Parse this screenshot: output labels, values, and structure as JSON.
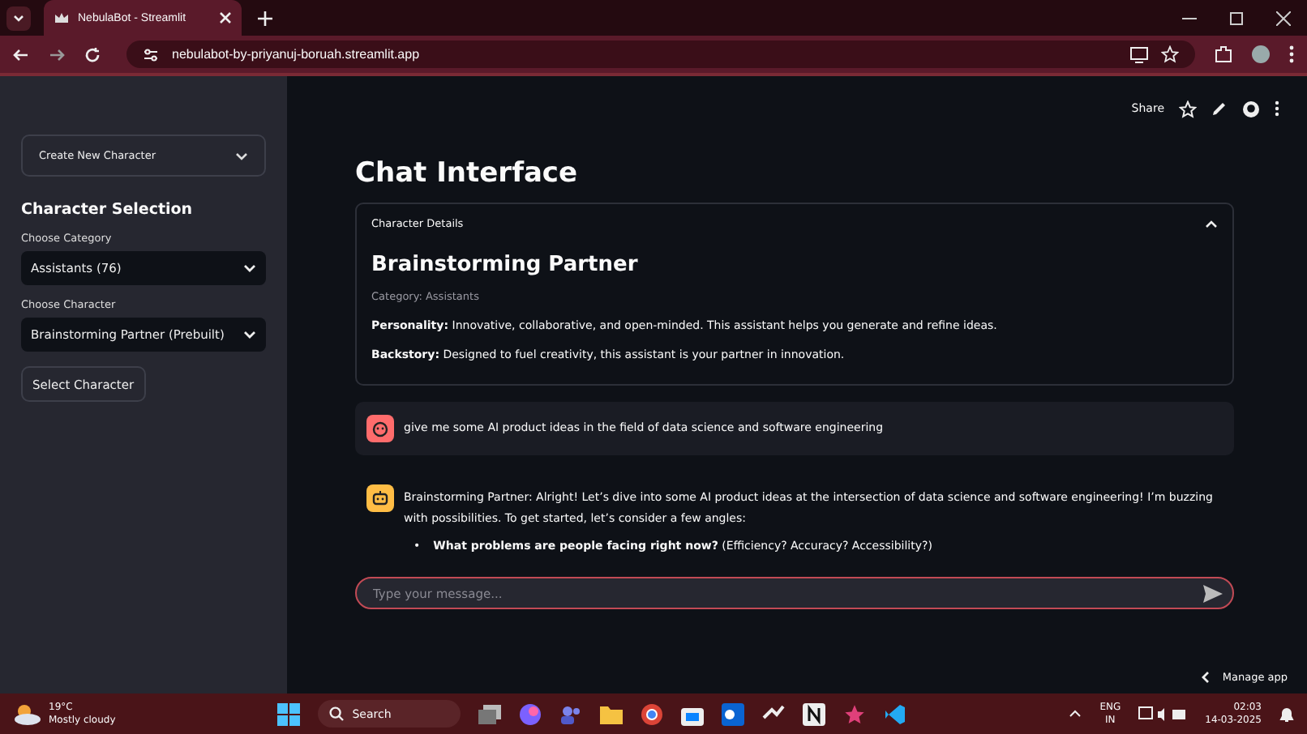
{
  "browser": {
    "tab_title": "NebulaBot - Streamlit",
    "url": "nebulabot-by-priyanuj-boruah.streamlit.app"
  },
  "app_toolbar": {
    "share": "Share"
  },
  "sidebar": {
    "expander": "Create New Character",
    "section_title": "Character Selection",
    "fields": [
      {
        "label": "Choose Category",
        "value": "Assistants (76)"
      },
      {
        "label": "Choose Character",
        "value": "Brainstorming Partner (Prebuilt)"
      }
    ],
    "button": "Select Character"
  },
  "main": {
    "title": "Chat Interface",
    "details": {
      "header": "Character Details",
      "expanded": true,
      "name": "Brainstorming Partner",
      "category": "Category: Assistants",
      "lines": [
        "**Personality:** Innovative, collaborative, and open-minded. This assistant helps you generate and refine ideas.",
        "**Backstory:** Designed to fuel creativity, this assistant is your partner in innovation."
      ]
    },
    "messages": [
      {
        "kind": "user",
        "text": "give me some AI product ideas in the field of data science and software engineering"
      },
      {
        "kind": "assistant",
        "text": "Brainstorming Partner: Alright! Let’s dive into some AI product ideas at the intersection of data science and software engineering! I’m buzzing with possibilities. To get started, let’s consider a few angles:",
        "bullets": [
          {
            "marker": "•",
            "text": "**What problems are people facing right now?** (Efficiency? Accuracy? Accessibility?)"
          }
        ]
      }
    ],
    "input": {
      "placeholder": "Type your message..."
    },
    "manage_app": "Manage app"
  },
  "taskbar": {
    "temperature": "19°C",
    "weather": "Mostly cloudy",
    "search": "Search",
    "lang": "ENG",
    "region": "IN",
    "time": "02:03",
    "date": "14-03-2025"
  }
}
